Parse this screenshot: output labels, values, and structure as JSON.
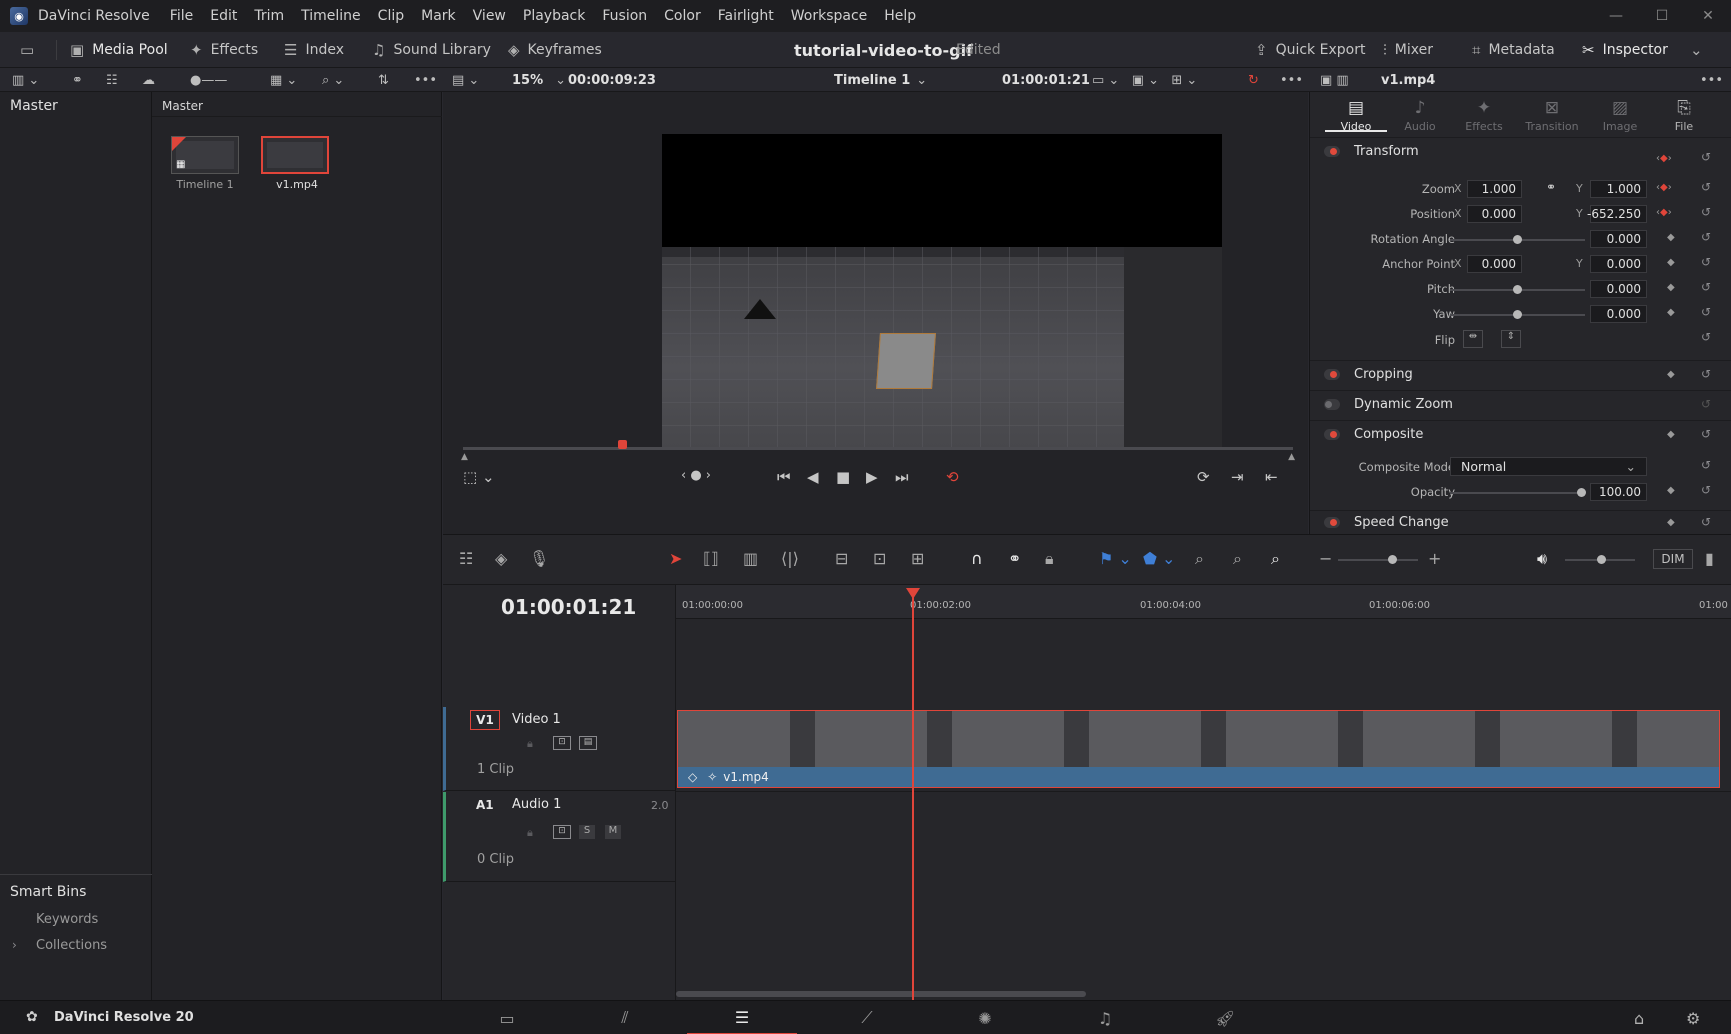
{
  "menubar": {
    "app_name": "DaVinci Resolve",
    "items": [
      "File",
      "Edit",
      "Trim",
      "Timeline",
      "Clip",
      "Mark",
      "View",
      "Playback",
      "Fusion",
      "Color",
      "Fairlight",
      "Workspace",
      "Help"
    ]
  },
  "toolbar": {
    "media_pool": "Media Pool",
    "effects": "Effects",
    "index": "Index",
    "sound_library": "Sound Library",
    "keyframes": "Keyframes",
    "project_title": "tutorial-video-to-gif",
    "project_status": "Edited",
    "quick_export": "Quick Export",
    "mixer": "Mixer",
    "metadata": "Metadata",
    "inspector": "Inspector"
  },
  "subbar": {
    "zoom": "15%",
    "duration": "00:00:09:23",
    "timeline_name": "Timeline 1",
    "timecode": "01:00:01:21",
    "clip_name": "v1.mp4"
  },
  "bins": {
    "master": "Master",
    "smart_bins": "Smart Bins",
    "keywords": "Keywords",
    "collections": "Collections"
  },
  "mediapool": {
    "header": "Master",
    "items": [
      {
        "label": "Timeline 1"
      },
      {
        "label": "v1.mp4"
      }
    ]
  },
  "inspector": {
    "tabs": [
      "Video",
      "Audio",
      "Effects",
      "Transition",
      "Image",
      "File"
    ],
    "transform": {
      "title": "Transform",
      "zoom_label": "Zoom",
      "zoom_x": "1.000",
      "zoom_y": "1.000",
      "position_label": "Position",
      "position_x": "0.000",
      "position_y": "-652.250",
      "rotation_label": "Rotation Angle",
      "rotation": "0.000",
      "anchor_label": "Anchor Point",
      "anchor_x": "0.000",
      "anchor_y": "0.000",
      "pitch_label": "Pitch",
      "pitch": "0.000",
      "yaw_label": "Yaw",
      "yaw": "0.000",
      "flip_label": "Flip",
      "x": "X",
      "y": "Y"
    },
    "cropping": "Cropping",
    "dynamic_zoom": "Dynamic Zoom",
    "composite": {
      "title": "Composite",
      "mode_label": "Composite Mode",
      "mode": "Normal",
      "opacity_label": "Opacity",
      "opacity": "100.00"
    },
    "speed_change": "Speed Change"
  },
  "timeline": {
    "timecode": "01:00:01:21",
    "ruler": [
      "01:00:00:00",
      "01:00:02:00",
      "01:00:04:00",
      "01:00:06:00",
      "01:00"
    ],
    "dim": "DIM",
    "video_track": {
      "id": "V1",
      "name": "Video 1",
      "count": "1 Clip"
    },
    "audio_track": {
      "id": "A1",
      "name": "Audio 1",
      "channels": "2.0",
      "count": "0 Clip",
      "solo": "S",
      "mute": "M"
    },
    "clip_label": "v1.mp4"
  },
  "footer": {
    "brand": "DaVinci Resolve 20"
  }
}
